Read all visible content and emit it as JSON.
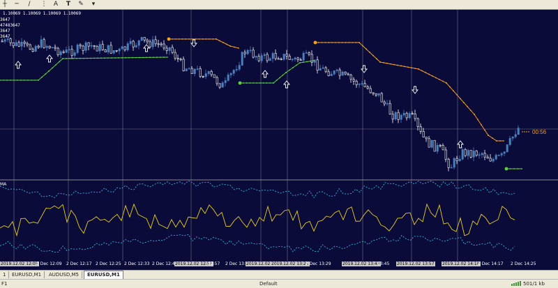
{
  "toolbar": {
    "items": [
      "─",
      "/",
      "A",
      "T"
    ]
  },
  "chart": {
    "ohlc_label": "1.10069 1.10069 1.10069 1.10069",
    "left_values": [
      "3647",
      "47483647",
      "3647",
      "3647"
    ],
    "timer": "00:56",
    "indicator_title": "MA",
    "time_labels": [
      {
        "text": "2019.12.02 12:05",
        "hl": true
      },
      {
        "text": "2 Dec 12:09",
        "hl": false
      },
      {
        "text": "2 Dec 12:17",
        "hl": false
      },
      {
        "text": "2 Dec 12:25",
        "hl": false
      },
      {
        "text": "2 Dec 12:33",
        "hl": false
      },
      {
        "text": "2 Dec 12:41",
        "hl": false
      },
      {
        "text": "2019.12.02 12:51",
        "hl": true
      },
      {
        "text": "12:57",
        "hl": false
      },
      {
        "text": "2 Dec 13:0",
        "hl": false
      },
      {
        "text": "2019.12.02",
        "hl": true
      },
      {
        "text": "2019.12.02 13:21",
        "hl": true
      },
      {
        "text": "2 Dec 13:29",
        "hl": false
      },
      {
        "text": "2019.12.02 13:43",
        "hl": true
      },
      {
        "text": "13:45",
        "hl": false
      },
      {
        "text": "2019.12.02 13:57",
        "hl": true
      },
      {
        "text": "2019.12.02 14:10",
        "hl": true
      },
      {
        "text": "2 Dec 14:17",
        "hl": false
      },
      {
        "text": "2 Dec 14:25",
        "hl": false
      }
    ]
  },
  "tabs": [
    {
      "label": "EURUSD,M1",
      "active": false
    },
    {
      "label": "AUDUSD,M5",
      "active": false
    },
    {
      "label": "EURUSD,M1",
      "active": true
    }
  ],
  "tab_prefix": "1",
  "status": {
    "help": "F1",
    "profile": "Default",
    "traffic": "501/1 kb"
  },
  "colors": {
    "background": "#0b0b3a",
    "bull_candle": "#4a7fc0",
    "bear_candle": "#ffffff",
    "sar_up": "#5bd43c",
    "sar_down": "#f4a020",
    "indicator_line": "#e8d020",
    "bands": "#2fb8e0",
    "grid": "#c8c8c8"
  }
}
